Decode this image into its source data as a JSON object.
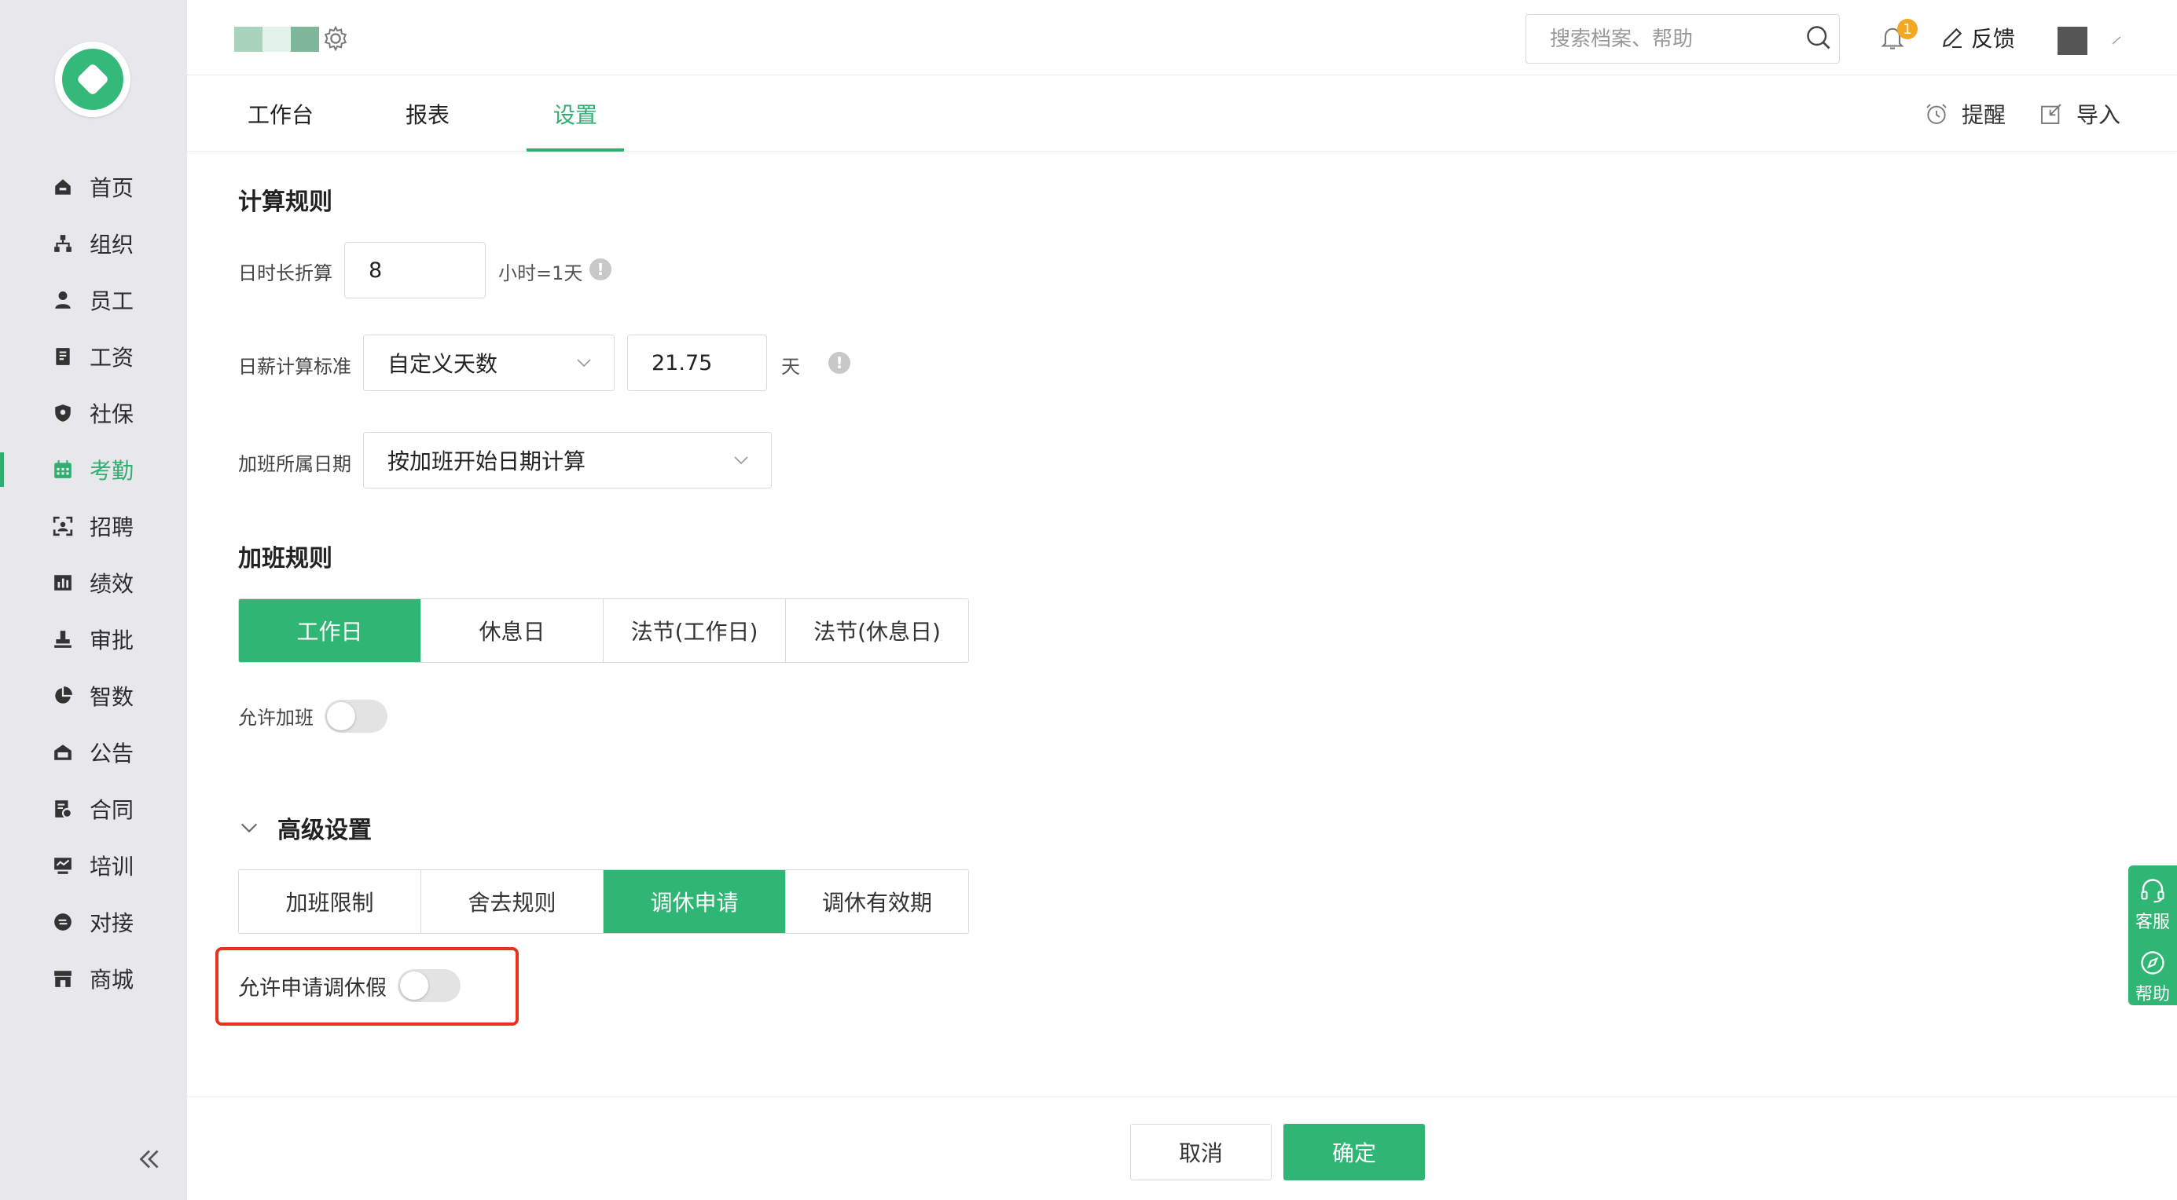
{
  "colors": {
    "accent": "#2fae6f",
    "highlight": "#e8321e",
    "badge": "#f5a623"
  },
  "sidebar": {
    "items": [
      {
        "label": "首页",
        "icon": "home-icon"
      },
      {
        "label": "组织",
        "icon": "org-tree-icon"
      },
      {
        "label": "员工",
        "icon": "person-icon"
      },
      {
        "label": "工资",
        "icon": "salary-icon"
      },
      {
        "label": "社保",
        "icon": "shield-icon"
      },
      {
        "label": "考勤",
        "icon": "calendar-icon",
        "active": true
      },
      {
        "label": "招聘",
        "icon": "scan-icon"
      },
      {
        "label": "绩效",
        "icon": "bar-chart-icon"
      },
      {
        "label": "审批",
        "icon": "stamp-icon"
      },
      {
        "label": "智数",
        "icon": "pie-chart-icon"
      },
      {
        "label": "公告",
        "icon": "announcement-icon"
      },
      {
        "label": "合同",
        "icon": "contract-icon"
      },
      {
        "label": "培训",
        "icon": "training-icon"
      },
      {
        "label": "对接",
        "icon": "connect-icon"
      },
      {
        "label": "商城",
        "icon": "store-icon"
      }
    ]
  },
  "header": {
    "search_placeholder": "搜索档案、帮助",
    "notification_count": "1",
    "feedback_label": "反馈"
  },
  "tabs": [
    {
      "label": "工作台"
    },
    {
      "label": "报表"
    },
    {
      "label": "设置",
      "active": true
    }
  ],
  "tab_actions": {
    "remind_label": "提醒",
    "import_label": "导入"
  },
  "calc_rules": {
    "title": "计算规则",
    "day_hours_label": "日时长折算",
    "day_hours_value": "8",
    "day_hours_unit": "小时=1天",
    "daily_salary_label": "日薪计算标准",
    "daily_salary_select": "自定义天数",
    "daily_salary_days": "21.75",
    "daily_salary_unit": "天",
    "overtime_date_label": "加班所属日期",
    "overtime_date_select": "按加班开始日期计算"
  },
  "overtime_rules": {
    "title": "加班规则",
    "segments": [
      "工作日",
      "休息日",
      "法节(工作日)",
      "法节(休息日)"
    ],
    "active_segment": 0,
    "allow_label": "允许加班",
    "allow_on": false
  },
  "advanced": {
    "title": "高级设置",
    "segments": [
      "加班限制",
      "舍去规则",
      "调休申请",
      "调休有效期"
    ],
    "active_segment": 2,
    "allow_leave_label": "允许申请调休假",
    "allow_leave_on": false
  },
  "footer": {
    "cancel_label": "取消",
    "confirm_label": "确定"
  },
  "float_panel": {
    "service_label": "客服",
    "help_label": "帮助"
  }
}
